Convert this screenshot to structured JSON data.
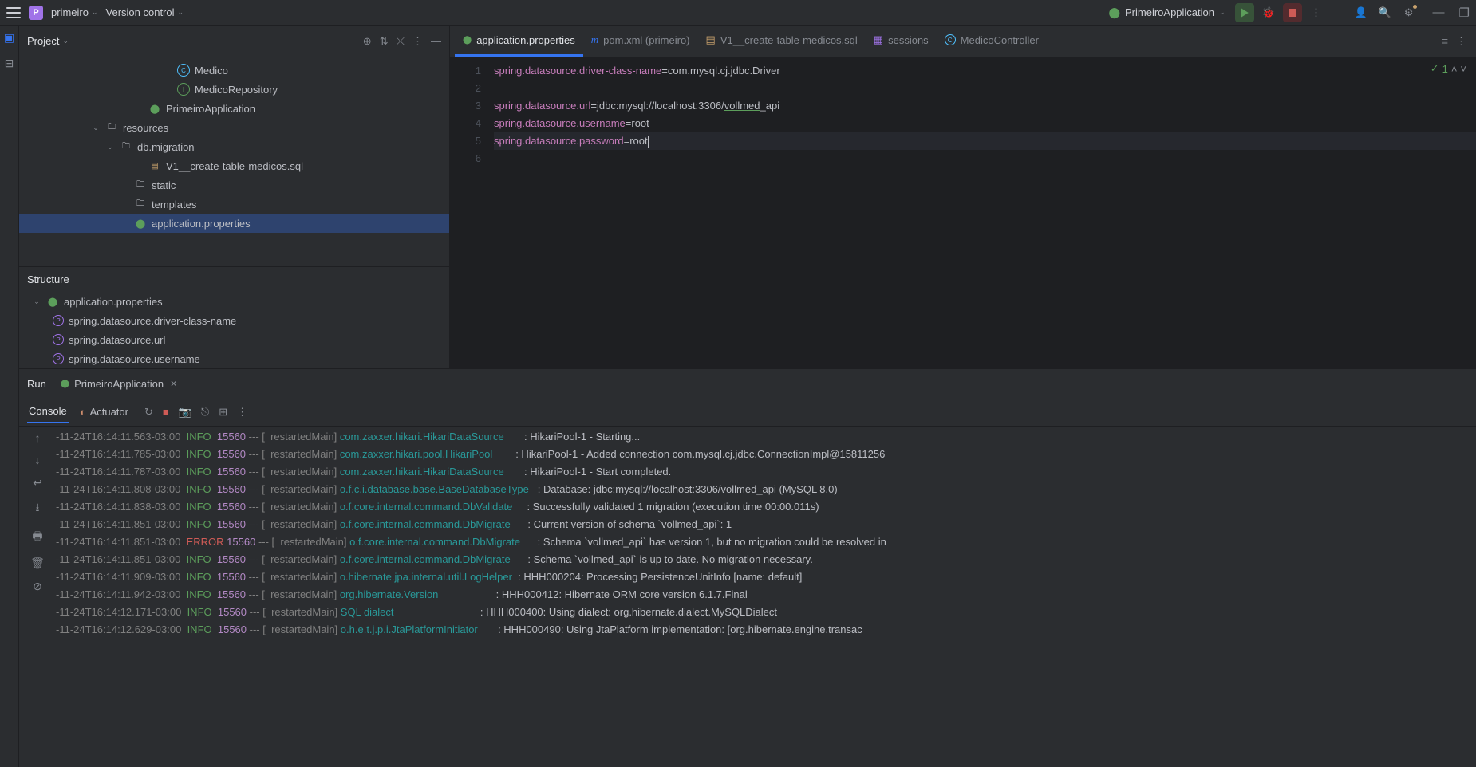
{
  "titlebar": {
    "project_name": "primeiro",
    "version_control": "Version control",
    "run_config": "PrimeiroApplication"
  },
  "project_panel": {
    "title": "Project",
    "tree": [
      {
        "indent": 10,
        "icon": "class",
        "label": "Medico",
        "interactable": true
      },
      {
        "indent": 10,
        "icon": "interface",
        "label": "MedicoRepository",
        "interactable": true
      },
      {
        "indent": 8,
        "icon": "props",
        "label": "PrimeiroApplication",
        "interactable": true
      },
      {
        "indent": 5,
        "expander": "v",
        "icon": "folder-res",
        "label": "resources",
        "interactable": true
      },
      {
        "indent": 6,
        "expander": "v",
        "icon": "folder",
        "label": "db.migration",
        "interactable": true
      },
      {
        "indent": 8,
        "icon": "sql",
        "label": "V1__create-table-medicos.sql",
        "interactable": true
      },
      {
        "indent": 7,
        "icon": "folder",
        "label": "static",
        "interactable": true
      },
      {
        "indent": 7,
        "icon": "folder",
        "label": "templates",
        "interactable": true
      },
      {
        "indent": 7,
        "icon": "props",
        "label": "application.properties",
        "selected": true,
        "interactable": true
      }
    ]
  },
  "structure": {
    "title": "Structure",
    "root": "application.properties",
    "items": [
      "spring.datasource.driver-class-name",
      "spring.datasource.url",
      "spring.datasource.username"
    ]
  },
  "tabs": [
    {
      "icon": "props",
      "label": "application.properties",
      "active": true
    },
    {
      "icon": "maven",
      "label": "pom.xml (primeiro)"
    },
    {
      "icon": "sql",
      "label": "V1__create-table-medicos.sql"
    },
    {
      "icon": "db",
      "label": "sessions"
    },
    {
      "icon": "class",
      "label": "MedicoController"
    }
  ],
  "problems_count": "1",
  "editor": {
    "lines": [
      {
        "n": 1,
        "key": "spring.datasource.driver-class-name",
        "val": "com.mysql.cj.jdbc.Driver"
      },
      {
        "n": 2,
        "empty": true
      },
      {
        "n": 3,
        "key": "spring.datasource.url",
        "val": "jdbc:mysql://localhost:3306/",
        "link": "vollmed",
        "suffix": "_api"
      },
      {
        "n": 4,
        "key": "spring.datasource.username",
        "val": "root"
      },
      {
        "n": 5,
        "key": "spring.datasource.password",
        "val": "root",
        "cursor": true,
        "hl": true
      },
      {
        "n": 6,
        "empty": true
      }
    ]
  },
  "run_panel": {
    "label": "Run",
    "tab": "PrimeiroApplication",
    "console": "Console",
    "actuator": "Actuator"
  },
  "log": [
    {
      "ts": "-11-24T16:14:11.563-03:00",
      "level": "INFO",
      "pid": "15560",
      "thread": "restartedMain",
      "cls": "com.zaxxer.hikari.HikariDataSource",
      "msg": "HikariPool-1 - Starting..."
    },
    {
      "ts": "-11-24T16:14:11.785-03:00",
      "level": "INFO",
      "pid": "15560",
      "thread": "restartedMain",
      "cls": "com.zaxxer.hikari.pool.HikariPool",
      "msg": "HikariPool-1 - Added connection com.mysql.cj.jdbc.ConnectionImpl@15811256"
    },
    {
      "ts": "-11-24T16:14:11.787-03:00",
      "level": "INFO",
      "pid": "15560",
      "thread": "restartedMain",
      "cls": "com.zaxxer.hikari.HikariDataSource",
      "msg": "HikariPool-1 - Start completed."
    },
    {
      "ts": "-11-24T16:14:11.808-03:00",
      "level": "INFO",
      "pid": "15560",
      "thread": "restartedMain",
      "cls": "o.f.c.i.database.base.BaseDatabaseType",
      "msg": "Database: jdbc:mysql://localhost:3306/vollmed_api (MySQL 8.0)"
    },
    {
      "ts": "-11-24T16:14:11.838-03:00",
      "level": "INFO",
      "pid": "15560",
      "thread": "restartedMain",
      "cls": "o.f.core.internal.command.DbValidate",
      "msg": "Successfully validated 1 migration (execution time 00:00.011s)"
    },
    {
      "ts": "-11-24T16:14:11.851-03:00",
      "level": "INFO",
      "pid": "15560",
      "thread": "restartedMain",
      "cls": "o.f.core.internal.command.DbMigrate",
      "msg": "Current version of schema `vollmed_api`: 1"
    },
    {
      "ts": "-11-24T16:14:11.851-03:00",
      "level": "ERROR",
      "pid": "15560",
      "thread": "restartedMain",
      "cls": "o.f.core.internal.command.DbMigrate",
      "msg": "Schema `vollmed_api` has version 1, but no migration could be resolved in"
    },
    {
      "ts": "-11-24T16:14:11.851-03:00",
      "level": "INFO",
      "pid": "15560",
      "thread": "restartedMain",
      "cls": "o.f.core.internal.command.DbMigrate",
      "msg": "Schema `vollmed_api` is up to date. No migration necessary."
    },
    {
      "ts": "-11-24T16:14:11.909-03:00",
      "level": "INFO",
      "pid": "15560",
      "thread": "restartedMain",
      "cls": "o.hibernate.jpa.internal.util.LogHelper",
      "msg": "HHH000204: Processing PersistenceUnitInfo [name: default]"
    },
    {
      "ts": "-11-24T16:14:11.942-03:00",
      "level": "INFO",
      "pid": "15560",
      "thread": "restartedMain",
      "cls": "org.hibernate.Version",
      "msg": "HHH000412: Hibernate ORM core version 6.1.7.Final"
    },
    {
      "ts": "-11-24T16:14:12.171-03:00",
      "level": "INFO",
      "pid": "15560",
      "thread": "restartedMain",
      "cls": "SQL dialect",
      "msg": "HHH000400: Using dialect: org.hibernate.dialect.MySQLDialect"
    },
    {
      "ts": "-11-24T16:14:12.629-03:00",
      "level": "INFO",
      "pid": "15560",
      "thread": "restartedMain",
      "cls": "o.h.e.t.j.p.i.JtaPlatformInitiator",
      "msg": "HHH000490: Using JtaPlatform implementation: [org.hibernate.engine.transac"
    }
  ]
}
